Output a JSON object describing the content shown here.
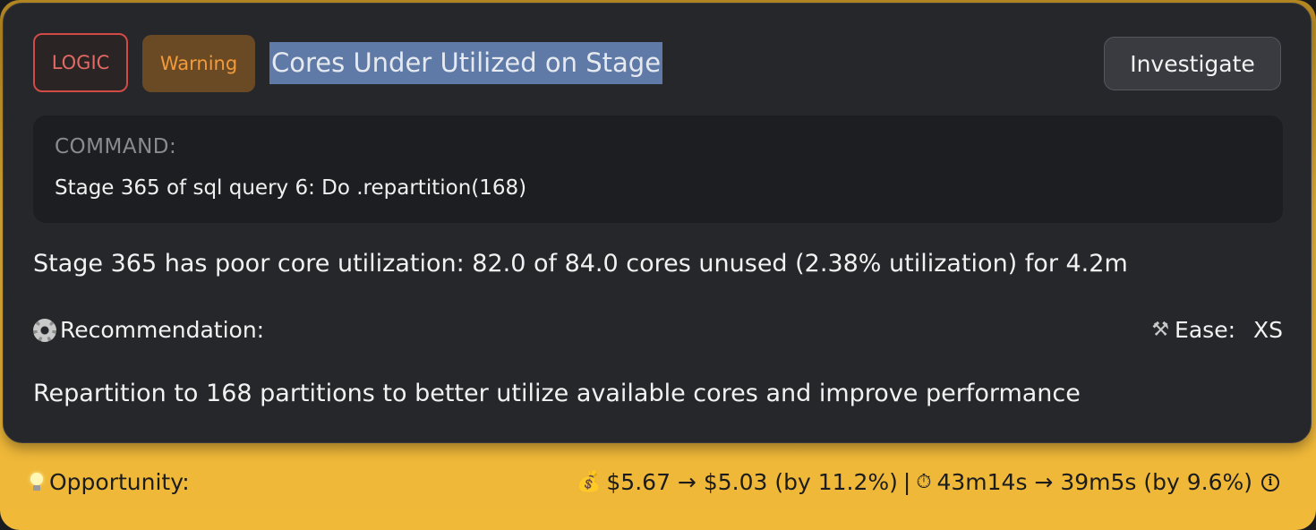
{
  "card": {
    "category_tag": "LOGIC",
    "severity_tag": "Warning",
    "title": "Cores Under Utilized on Stage",
    "investigate_label": "Investigate",
    "command": {
      "label": "COMMAND:",
      "text": "Stage 365 of sql query 6: Do .repartition(168)"
    },
    "description": "Stage 365 has poor core utilization: 82.0 of 84.0 cores unused (2.38% utilization) for 4.2m",
    "recommendation_label": "Recommendation:",
    "ease_label": "Ease:",
    "ease_value": "XS",
    "recommendation_text": "Repartition to 168 partitions to better utilize available cores and improve performance"
  },
  "opportunity": {
    "label": "Opportunity:",
    "cost": "$5.67 → $5.03 (by 11.2%)",
    "separator": "|",
    "time": "43m14s → 39m5s (by 9.6%)"
  },
  "icons": {
    "gear": "gear-icon",
    "hammer": "hammer-icon",
    "bulb": "light-bulb-icon",
    "moneybag": "money-bag-icon",
    "stopwatch": "stopwatch-icon",
    "info": "info-icon"
  },
  "colors": {
    "logic_tag": "#e36a63",
    "warning_tag_text": "#f39a3a",
    "warning_tag_bg": "#6a4a25",
    "opportunity_bg": "#f1b938",
    "card_bg": "#26272b",
    "title_highlight": "#5f7aa6"
  }
}
